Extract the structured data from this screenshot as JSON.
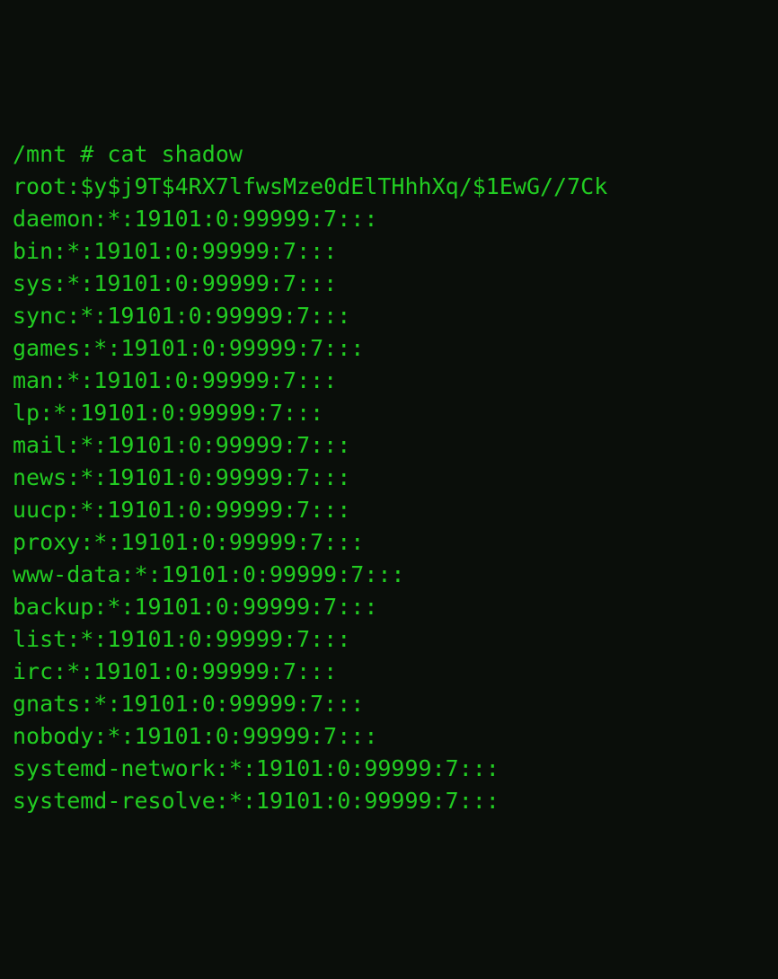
{
  "prompt": {
    "path": "/mnt",
    "symbol": "#",
    "command": "cat shadow"
  },
  "lines": [
    "root:$y$j9T$4RX7lfwsMze0dElTHhhXq/$1EwG//7Ck",
    "daemon:*:19101:0:99999:7:::",
    "bin:*:19101:0:99999:7:::",
    "sys:*:19101:0:99999:7:::",
    "sync:*:19101:0:99999:7:::",
    "games:*:19101:0:99999:7:::",
    "man:*:19101:0:99999:7:::",
    "lp:*:19101:0:99999:7:::",
    "mail:*:19101:0:99999:7:::",
    "news:*:19101:0:99999:7:::",
    "uucp:*:19101:0:99999:7:::",
    "proxy:*:19101:0:99999:7:::",
    "www-data:*:19101:0:99999:7:::",
    "backup:*:19101:0:99999:7:::",
    "list:*:19101:0:99999:7:::",
    "irc:*:19101:0:99999:7:::",
    "gnats:*:19101:0:99999:7:::",
    "nobody:*:19101:0:99999:7:::",
    "systemd-network:*:19101:0:99999:7:::",
    "systemd-resolve:*:19101:0:99999:7:::"
  ]
}
